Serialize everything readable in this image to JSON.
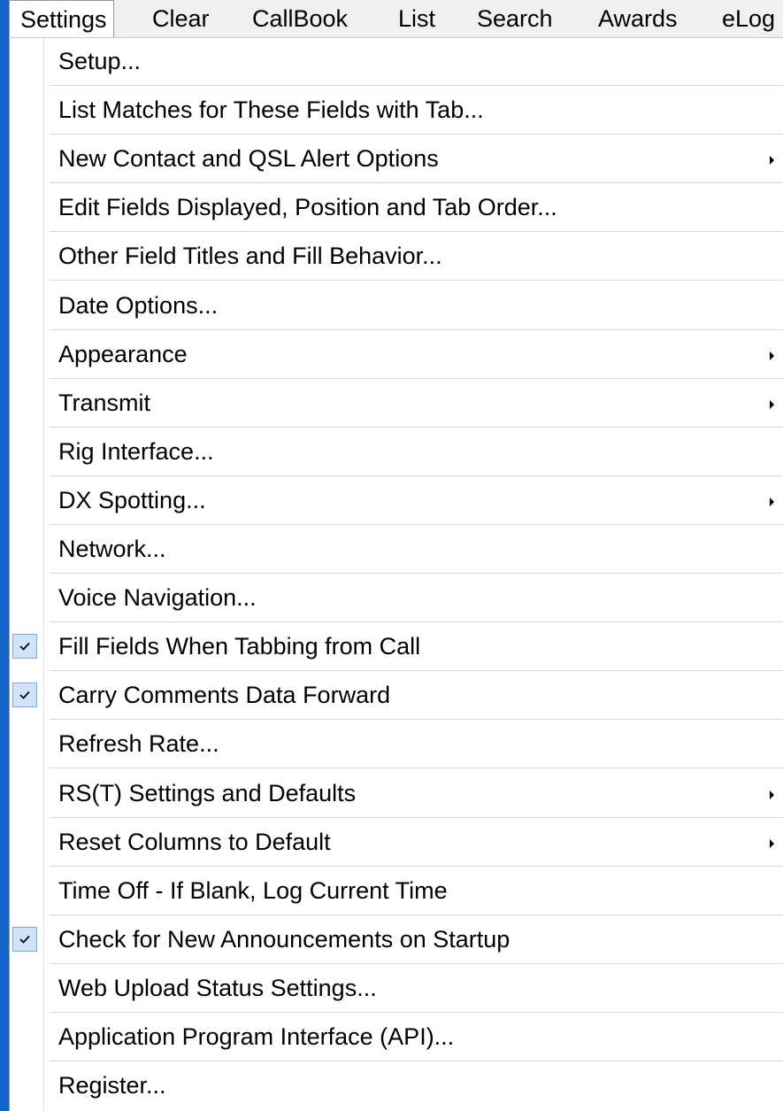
{
  "menubar": {
    "items": [
      {
        "label": "Settings",
        "active": true
      },
      {
        "label": "Clear",
        "active": false
      },
      {
        "label": "CallBook",
        "active": false
      },
      {
        "label": "List",
        "active": false
      },
      {
        "label": "Search",
        "active": false
      },
      {
        "label": "Awards",
        "active": false
      },
      {
        "label": "eLog",
        "active": false
      }
    ]
  },
  "settings_menu": {
    "items": [
      {
        "label": "Setup...",
        "submenu": false,
        "checked": false
      },
      {
        "label": "List Matches for These Fields with Tab...",
        "submenu": false,
        "checked": false
      },
      {
        "label": "New Contact and QSL Alert Options",
        "submenu": true,
        "checked": false
      },
      {
        "label": "Edit Fields Displayed, Position and Tab Order...",
        "submenu": false,
        "checked": false
      },
      {
        "label": "Other Field Titles and Fill Behavior...",
        "submenu": false,
        "checked": false
      },
      {
        "label": "Date Options...",
        "submenu": false,
        "checked": false
      },
      {
        "label": "Appearance",
        "submenu": true,
        "checked": false
      },
      {
        "label": "Transmit",
        "submenu": true,
        "checked": false
      },
      {
        "label": "Rig Interface...",
        "submenu": false,
        "checked": false
      },
      {
        "label": "DX Spotting...",
        "submenu": true,
        "checked": false
      },
      {
        "label": "Network...",
        "submenu": false,
        "checked": false
      },
      {
        "label": "Voice Navigation...",
        "submenu": false,
        "checked": false
      },
      {
        "label": "Fill Fields When Tabbing from Call",
        "submenu": false,
        "checked": true
      },
      {
        "label": "Carry Comments Data Forward",
        "submenu": false,
        "checked": true
      },
      {
        "label": "Refresh Rate...",
        "submenu": false,
        "checked": false
      },
      {
        "label": "RS(T) Settings and Defaults",
        "submenu": true,
        "checked": false
      },
      {
        "label": "Reset Columns to Default",
        "submenu": true,
        "checked": false
      },
      {
        "label": "Time Off - If Blank, Log Current Time",
        "submenu": false,
        "checked": false
      },
      {
        "label": "Check for New Announcements on Startup",
        "submenu": false,
        "checked": true
      },
      {
        "label": "Web Upload Status Settings...",
        "submenu": false,
        "checked": false
      },
      {
        "label": "Application Program Interface (API)...",
        "submenu": false,
        "checked": false
      },
      {
        "label": "Register...",
        "submenu": false,
        "checked": false
      }
    ]
  },
  "icons": {
    "check": "checkmark-icon",
    "submenu": "submenu-arrow-icon"
  },
  "colors": {
    "background": "#1a6fd6",
    "menu_bg": "#ffffff",
    "menubar_bg": "#f0f0f0",
    "check_bg": "#cfe3fb",
    "check_border": "#7aa7e6"
  }
}
